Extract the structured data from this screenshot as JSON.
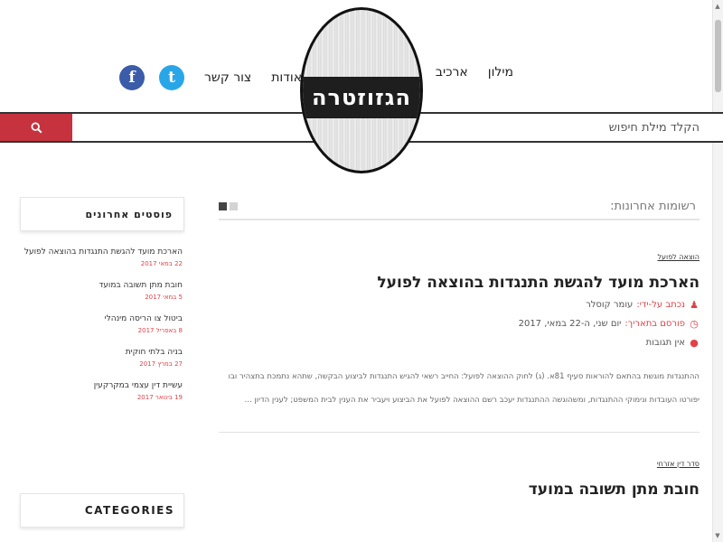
{
  "header": {
    "logo_text": "הגזוזטרה",
    "nav": [
      {
        "label": "מילון"
      },
      {
        "label": "ארכיב"
      },
      {
        "label": "אודות"
      },
      {
        "label": "צור קשר"
      }
    ],
    "social": [
      {
        "name": "twitter",
        "glyph": "t",
        "color": "#29a6e8"
      },
      {
        "name": "facebook",
        "glyph": "f",
        "color": "#3b5ca9"
      }
    ]
  },
  "search": {
    "placeholder": "הקלד מילת חיפוש",
    "button_color": "#c6323e"
  },
  "main": {
    "section_title": "רשומות אחרונות:",
    "posts": [
      {
        "category": "הוצאה לפועל",
        "title": "הארכת מועד להגשת התנגדות בהוצאה לפועל",
        "author_label": "נכתב על-ידי:",
        "author": "עומר קוסלר",
        "date_label": "פורסם בתאריך:",
        "date": "יום שני, ה-22 במאי, 2017",
        "comments": "אין תגובות",
        "excerpt": "ההתנגדות מוגשת בהתאם להוראות סעיף 81א. (ג) לחוק ההוצאה לפועל: החייב רשאי להגיש התנגדות לביצוע הבקשה, שתהא נתמכת בתצהיר ובו יפורטו העובדות ונימוקי ההתנגדות, ומשהוגשה ההתנגדות יעכב רשם ההוצאה לפועל את הביצוע ויעביר את הענין לבית המשפט; לענין הדיון ..."
      },
      {
        "category": "סדר דין אזרחי",
        "title": "חובת מתן תשובה במועד"
      }
    ]
  },
  "sidebar": {
    "recent_title": "פוסטים אחרונים",
    "recent_posts": [
      {
        "title": "הארכת מועד להגשת התנגדות בהוצאה לפועל",
        "date": "22 במאי 2017"
      },
      {
        "title": "חובת מתן תשובה במועד",
        "date": "5 במאי 2017"
      },
      {
        "title": "ביטול צו הריסה מינהלי",
        "date": "8 באפריל 2017"
      },
      {
        "title": "בניה בלתי חוקית",
        "date": "27 במרץ 2017"
      },
      {
        "title": "עשיית דין עצמי במקרקעין",
        "date": "19 בינואר 2017"
      }
    ],
    "categories_title": "CATEGORIES"
  },
  "colors": {
    "accent": "#e0424a",
    "search_button": "#c6323e"
  }
}
